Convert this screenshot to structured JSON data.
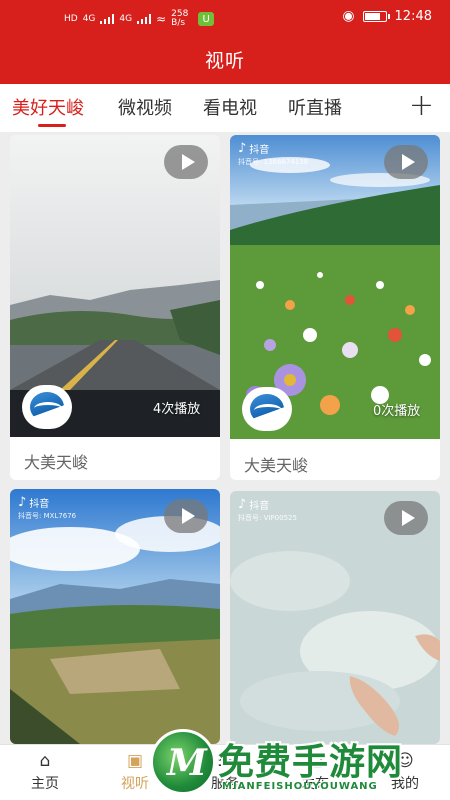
{
  "status_bar": {
    "network_left": "HD",
    "signal_1": "4G",
    "signal_2": "4G",
    "speed": "258 B/s",
    "app_badge": "U",
    "time": "12:48"
  },
  "header": {
    "title": "视听"
  },
  "tabs": [
    {
      "label": "美好天峻",
      "active": true
    },
    {
      "label": "微视频",
      "active": false
    },
    {
      "label": "看电视",
      "active": false
    },
    {
      "label": "听直播",
      "active": false
    }
  ],
  "add_tab_symbol": "+",
  "cards": [
    {
      "play_count": "4次播放",
      "caption": "大美天峻"
    },
    {
      "play_count": "0次播放",
      "caption": "大美天峻",
      "tiktok_label": "抖音",
      "tiktok_id": "抖音号: 1366674138"
    },
    {
      "tiktok_label": "抖音",
      "tiktok_id": "抖音号: MXL7676"
    },
    {
      "tiktok_label": "抖音",
      "tiktok_id": "抖音号: VIP00525"
    }
  ],
  "bottom_nav": [
    {
      "label": "主页",
      "icon": "home-icon",
      "active": false
    },
    {
      "label": "视听",
      "icon": "video-icon",
      "active": true
    },
    {
      "label": "服务",
      "icon": "grid-icon",
      "active": false
    },
    {
      "label": "发布",
      "icon": "publish-icon",
      "active": false
    },
    {
      "label": "我的",
      "icon": "user-icon",
      "active": false
    }
  ],
  "watermark": {
    "title": "免费手游网",
    "subtitle": "MIANFEISHOUYOUWANG"
  },
  "colors": {
    "brand_red": "#d7201b",
    "nav_active": "#d4a25a"
  }
}
